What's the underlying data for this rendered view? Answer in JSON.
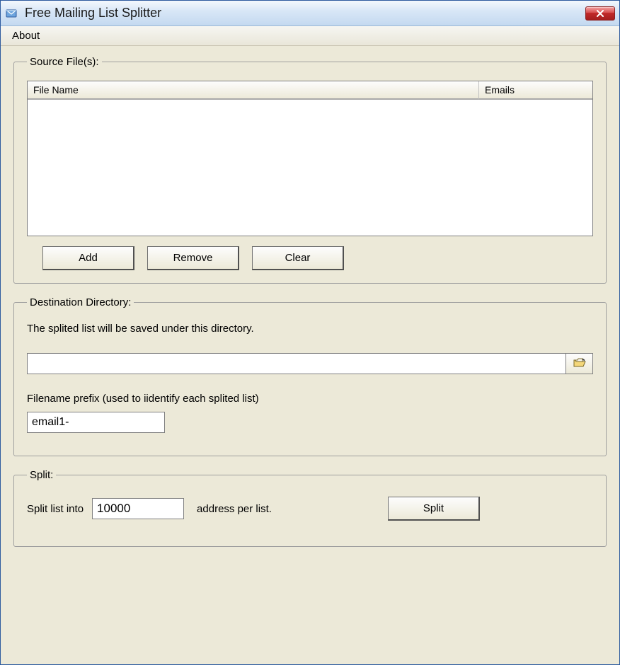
{
  "window": {
    "title": "Free Mailing List Splitter"
  },
  "menu": {
    "about": "About"
  },
  "source": {
    "legend": "Source File(s):",
    "columns": {
      "filename": "File Name",
      "emails": "Emails"
    },
    "rows": [],
    "buttons": {
      "add": "Add",
      "remove": "Remove",
      "clear": "Clear"
    }
  },
  "destination": {
    "legend": "Destination Directory:",
    "description": "The splited list will be saved under this directory.",
    "directory_value": "",
    "prefix_label": "Filename prefix (used to iidentify each splited list)",
    "prefix_value": "email1-"
  },
  "split": {
    "legend": "Split:",
    "label_before": "Split list into",
    "count_value": "10000",
    "label_after": "address per list.",
    "button": "Split"
  }
}
